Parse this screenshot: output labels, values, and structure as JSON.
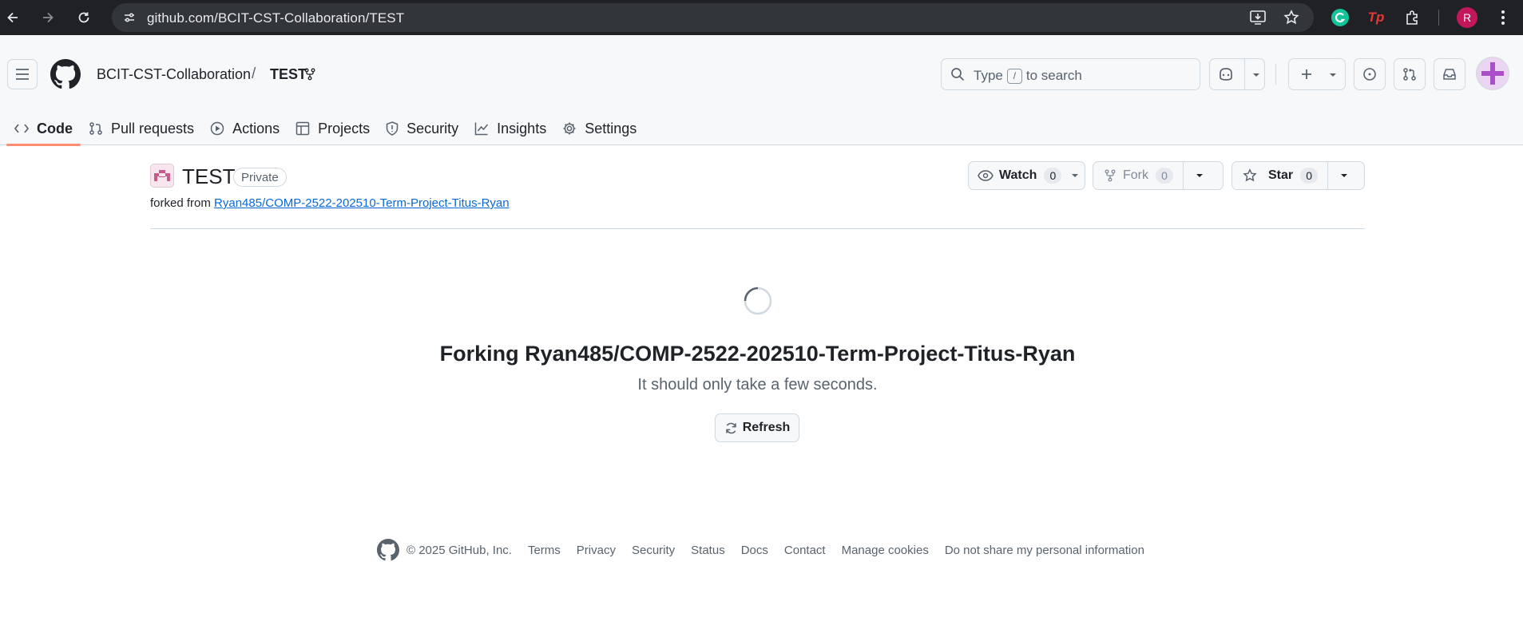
{
  "browser": {
    "url": "github.com/BCIT-CST-Collaboration/TEST",
    "profile_initial": "R",
    "ext_tp_label": "Tp"
  },
  "header": {
    "owner": "BCIT-CST-Collaboration",
    "separator": "/",
    "repo": "TEST",
    "search_prefix": "Type",
    "search_key": "/",
    "search_suffix": "to search"
  },
  "tabs": [
    {
      "label": "Code",
      "icon": "code-icon",
      "active": true
    },
    {
      "label": "Pull requests",
      "icon": "git-pull-request-icon"
    },
    {
      "label": "Actions",
      "icon": "play-icon"
    },
    {
      "label": "Projects",
      "icon": "table-icon"
    },
    {
      "label": "Security",
      "icon": "shield-icon"
    },
    {
      "label": "Insights",
      "icon": "graph-icon"
    },
    {
      "label": "Settings",
      "icon": "gear-icon"
    }
  ],
  "repo": {
    "name": "TEST",
    "visibility": "Private",
    "forked_from_prefix": "forked from",
    "forked_from_link": "Ryan485/COMP-2522-202510-Term-Project-Titus-Ryan"
  },
  "actions": {
    "watch": {
      "label": "Watch",
      "count": "0"
    },
    "fork": {
      "label": "Fork",
      "count": "0"
    },
    "star": {
      "label": "Star",
      "count": "0"
    }
  },
  "status": {
    "heading": "Forking Ryan485/COMP-2522-202510-Term-Project-Titus-Ryan",
    "sub": "It should only take a few seconds.",
    "refresh_label": "Refresh"
  },
  "footer": {
    "copyright": "© 2025 GitHub, Inc.",
    "links": [
      "Terms",
      "Privacy",
      "Security",
      "Status",
      "Docs",
      "Contact",
      "Manage cookies",
      "Do not share my personal information"
    ]
  },
  "colors": {
    "chrome_bg": "#202124",
    "omnibox_bg": "#323639",
    "header_bg": "#f6f8fa",
    "active_tab_underline": "#fd8c73",
    "link": "#0969da",
    "muted_text": "#59636e",
    "profile_avatar": "#c2185b"
  }
}
